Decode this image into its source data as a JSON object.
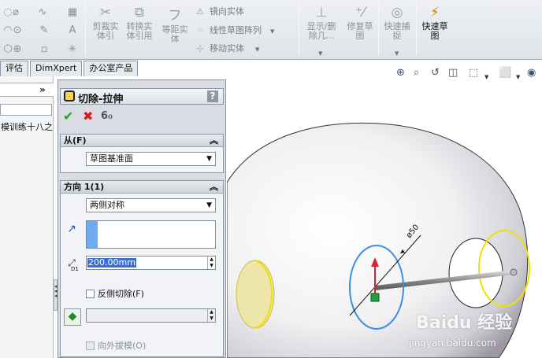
{
  "toolbar": {
    "trim": "剪裁实体引",
    "convert": "转换实体引用",
    "offset": "等距实体",
    "mirror": "镜向实体",
    "linear_pattern": "线性草图阵列",
    "move": "移动实体",
    "show_delete": "显示/删除几...",
    "repair": "修复草图",
    "quick_snaps": "快速捕捉",
    "rapid_sketch": "快速草图"
  },
  "tabs": [
    "评估",
    "DimXpert",
    "办公室产品"
  ],
  "tree": {
    "expand": "»",
    "item": "模训练十八之"
  },
  "pm": {
    "title": "切除-拉伸",
    "help": "?",
    "from": {
      "header": "从(F)",
      "value": "草图基准面"
    },
    "direction": {
      "header": "方向 1(1)",
      "end_condition": "两侧对称",
      "depth": "200.00mm",
      "depth_label": "D1",
      "flip_side": "反侧切除(F)",
      "draft_outward": "向外拔模(O)"
    }
  },
  "viewport": {
    "dimension": "ø50",
    "watermark": "Baidu 经验",
    "watermark_url": "jingyan.baidu.com"
  },
  "colors": {
    "ok": "#2f9e1e",
    "cancel": "#d31f1f",
    "circle_blue": "#3b8ee6",
    "circle_yellow": "#f2e000",
    "arrow_red": "#e0202a"
  }
}
